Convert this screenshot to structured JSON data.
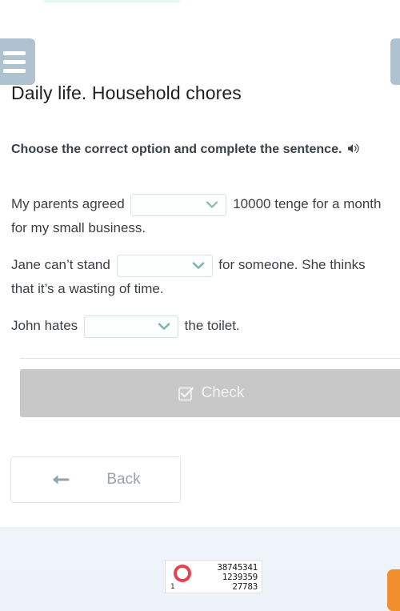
{
  "window": {
    "background_color": "#eef3f9",
    "card_color": "#ffffff",
    "accent_color": "#afc2cf",
    "orange_color": "#f18f2c"
  },
  "nav": {
    "menu_icon": "hamburger-menu-icon",
    "right_tab_label": "",
    "orange_tab_label": ""
  },
  "header": {
    "title": "Daily life. Household chores"
  },
  "task": {
    "instruction": "Choose the correct option and complete the sentence.",
    "audio_icon": "speaker-icon"
  },
  "sentences": [
    {
      "before": "My parents agreed",
      "after": "10000 tenge for a month for my small business.",
      "selected_value": "",
      "placeholder": ""
    },
    {
      "before": "Jane can’t stand",
      "after": "for someone. She thinks that it’s a wasting of time.",
      "selected_value": "",
      "placeholder": ""
    },
    {
      "before": "John hates",
      "after": "the toilet.",
      "selected_value": "",
      "placeholder": ""
    }
  ],
  "actions": {
    "check_label": "Check",
    "check_icon": "check-square-icon",
    "check_disabled_color": "#c8c8c8",
    "back_label": "Back",
    "back_icon": "arrow-left-icon"
  },
  "counter": {
    "index": "1",
    "ring_color": "#e8414e",
    "values": [
      "38745341",
      "1239359",
      "27783"
    ]
  }
}
